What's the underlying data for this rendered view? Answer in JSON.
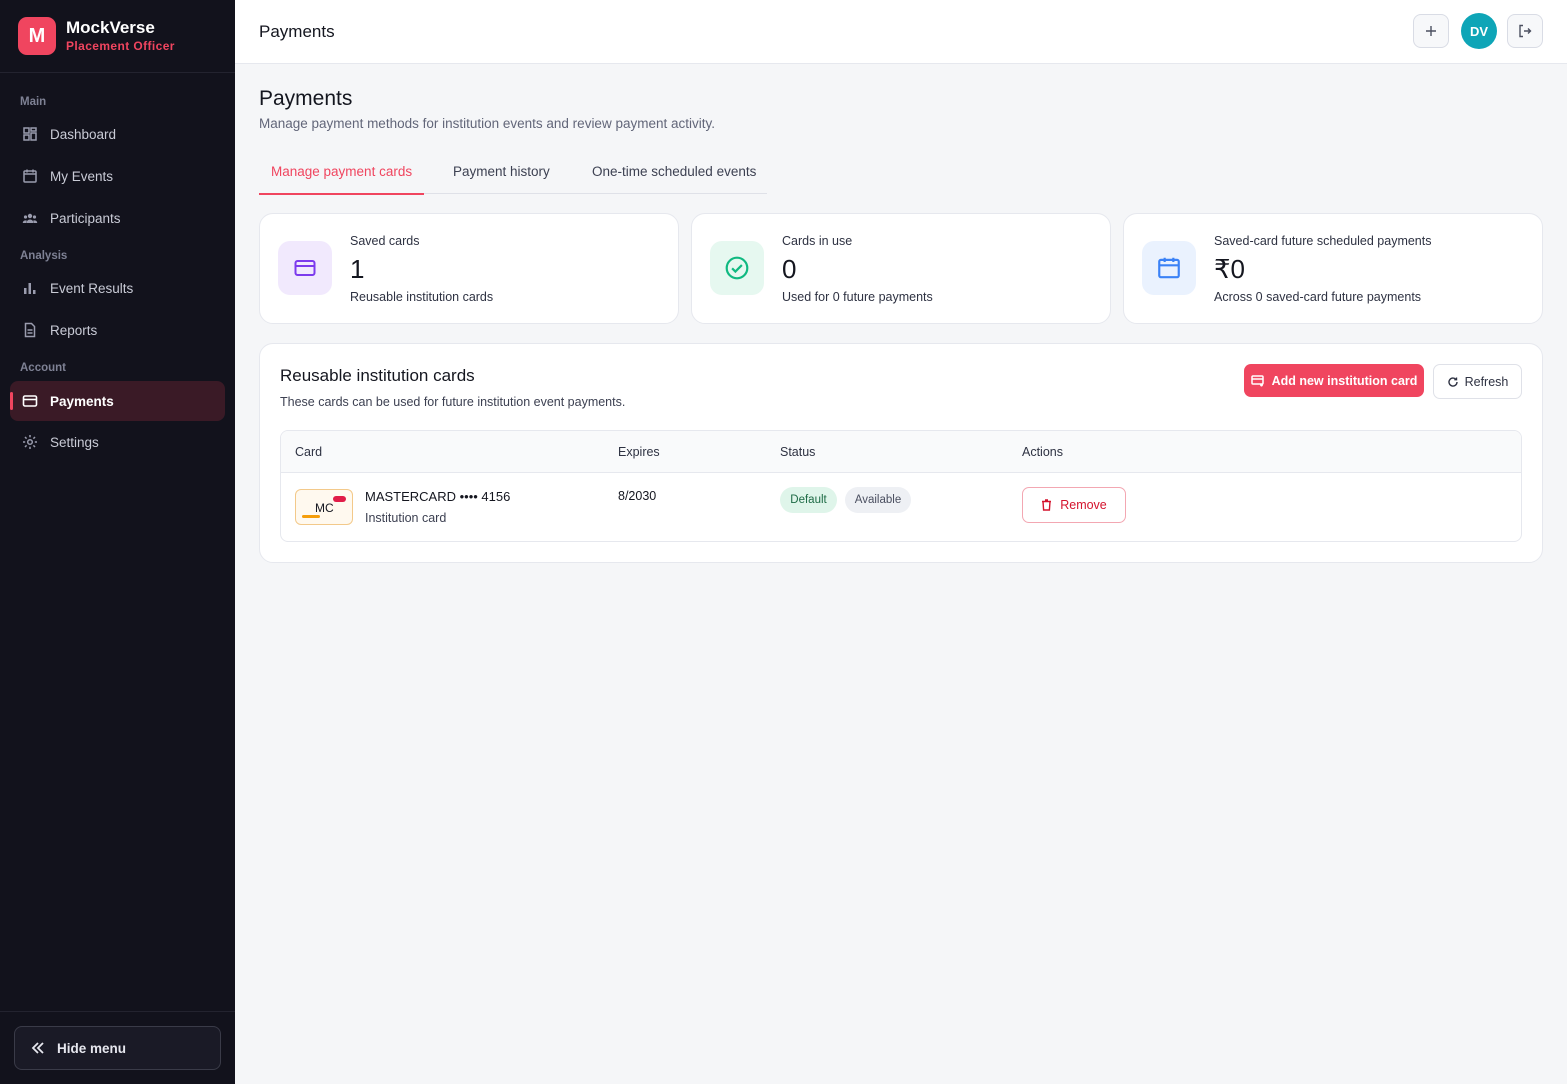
{
  "brand": {
    "logo_letter": "M",
    "name": "MockVerse",
    "role": "Placement Officer"
  },
  "sidebar": {
    "sections": [
      "Main",
      "Analysis",
      "Account"
    ],
    "items": [
      {
        "label": "Dashboard",
        "icon": "dashboard-icon"
      },
      {
        "label": "My Events",
        "icon": "calendar-icon"
      },
      {
        "label": "Participants",
        "icon": "users-icon"
      },
      {
        "label": "Event Results",
        "icon": "bar-chart-icon"
      },
      {
        "label": "Reports",
        "icon": "document-icon"
      },
      {
        "label": "Payments",
        "icon": "credit-card-icon",
        "active": true
      },
      {
        "label": "Settings",
        "icon": "gear-icon"
      }
    ],
    "hide_menu_label": "Hide menu"
  },
  "topbar": {
    "title": "Payments",
    "avatar_initials": "DV"
  },
  "page": {
    "title": "Payments",
    "subtitle": "Manage payment methods for institution events and review payment activity."
  },
  "tabs": [
    {
      "label": "Manage payment cards",
      "active": true
    },
    {
      "label": "Payment history",
      "active": false
    },
    {
      "label": "One-time scheduled events",
      "active": false
    }
  ],
  "stats": [
    {
      "label": "Saved cards",
      "value": "1",
      "sub": "Reusable institution cards",
      "icon": "credit-card-icon",
      "color": "#7c3aed",
      "bg": "#f1e9fd"
    },
    {
      "label": "Cards in use",
      "value": "0",
      "sub": "Used for 0 future payments",
      "icon": "check-circle-icon",
      "color": "#10b981",
      "bg": "#e6f8f0"
    },
    {
      "label": "Saved-card future scheduled payments",
      "value": "₹0",
      "sub": "Across 0 saved-card future payments",
      "icon": "calendar-icon",
      "color": "#3b82f6",
      "bg": "#eaf2fe"
    }
  ],
  "panel": {
    "title": "Reusable institution cards",
    "subtitle": "These cards can be used for future institution event payments.",
    "add_label": "Add new institution card",
    "refresh_label": "Refresh",
    "columns": [
      "Card",
      "Expires",
      "Status",
      "Actions"
    ],
    "rows": [
      {
        "thumb_text": "MC",
        "name": "MASTERCARD •••• 4156",
        "type": "Institution card",
        "expires": "8/2030",
        "badges": [
          "Default",
          "Available"
        ],
        "action": "Remove"
      }
    ]
  },
  "colors": {
    "accent": "#f0455f",
    "sidebar_bg": "#12121c",
    "avatar": "#0ea5b7"
  }
}
